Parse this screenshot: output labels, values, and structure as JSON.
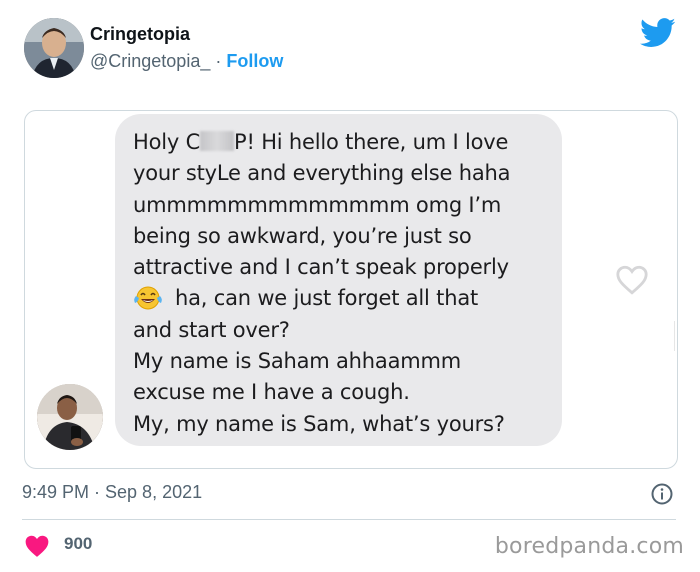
{
  "author": {
    "name": "Cringetopia",
    "handle": "@Cringetopia_",
    "separator": " · ",
    "follow_label": "Follow"
  },
  "icons": {
    "brand": "twitter-bird-icon",
    "avatar": "profile-photo",
    "embedded_heart": "heart-outline-icon",
    "emoji": "tears-of-joy-emoji",
    "info": "info-icon",
    "like": "heart-filled-icon"
  },
  "message": {
    "line1_before": "Holy C",
    "line1_after": "P! Hi hello there, um I love",
    "line2": "your styLe and everything else haha",
    "line3": "ummmmmmmmmmmmm omg I’m",
    "line4": "being so awkward, you’re just so",
    "line5": "attractive and I can’t speak properly",
    "line6": "ha, can we just forget all that",
    "line7": "and start over?",
    "line8": "My name is Saham ahhaammm",
    "line9": "excuse me I have a cough.",
    "line10": "My, my name is Sam, what’s yours?"
  },
  "meta": {
    "timestamp": "9:49 PM · Sep 8, 2021",
    "like_count": "900"
  },
  "watermark": "boredpanda.com",
  "colors": {
    "twitter_blue": "#1d9bf0",
    "like_red": "#f91880",
    "bubble_gray": "#e9e9eb",
    "meta_gray": "#536471"
  }
}
